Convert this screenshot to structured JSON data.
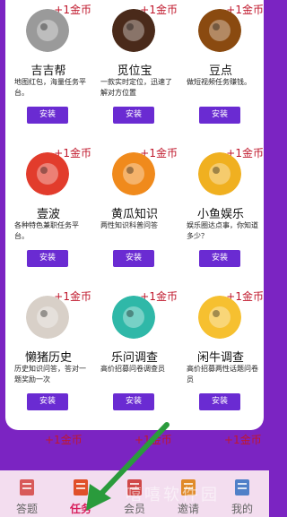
{
  "apps": [
    {
      "name": "吉吉帮",
      "desc": "地图红包，海量任务平台。",
      "reward": "+1金币",
      "button": "安装",
      "icon": "monkey-face-icon",
      "color": "#9a9a9a"
    },
    {
      "name": "觅位宝",
      "desc": "一款实时定位，迅速了解对方位置",
      "reward": "+1金币",
      "button": "安装",
      "icon": "location-pin-icon",
      "color": "#4a2a1a"
    },
    {
      "name": "豆点",
      "desc": "做短视频任务赚钱。",
      "reward": "+1金币",
      "button": "安装",
      "icon": "green-bean-icon",
      "color": "#8a4a10"
    },
    {
      "name": "壹波",
      "desc": "各种特色兼职任务平台。",
      "reward": "+1金币",
      "button": "安装",
      "icon": "red-letter-icon",
      "color": "#e23c2c"
    },
    {
      "name": "黄瓜知识",
      "desc": "两性知识科普问答",
      "reward": "+1金币",
      "button": "安装",
      "icon": "orange-leaf-icon",
      "color": "#f08a1c"
    },
    {
      "name": "小鱼娱乐",
      "desc": "娱乐圈达点事，你知道多少？",
      "reward": "+1金币",
      "button": "安装",
      "icon": "cartoon-fish-icon",
      "color": "#f0b020"
    },
    {
      "name": "懒猪历史",
      "desc": "历史知识问答，答对一题奖励一次",
      "reward": "+1金币",
      "button": "安装",
      "icon": "lazy-pig-icon",
      "color": "#d8d0c8"
    },
    {
      "name": "乐问调查",
      "desc": "高价招募问卷调查员",
      "reward": "+1金币",
      "button": "安装",
      "icon": "checklist-icon",
      "color": "#2fb8a8"
    },
    {
      "name": "闲牛调查",
      "desc": "高价招募两性话题问卷员",
      "reward": "+1金币",
      "button": "安装",
      "icon": "cartoon-cow-icon",
      "color": "#f6c030"
    }
  ],
  "peek_rewards": [
    "+1金币",
    "+1金币",
    "+1金币"
  ],
  "tabs": [
    {
      "label": "答题",
      "icon": "clipboard-icon",
      "color": "#d85a5a"
    },
    {
      "label": "任务",
      "icon": "task-book-icon",
      "color": "#e0502a"
    },
    {
      "label": "会员",
      "icon": "building-icon",
      "color": "#d04848"
    },
    {
      "label": "邀请",
      "icon": "person-icon",
      "color": "#e08a2a"
    },
    {
      "label": "我的",
      "icon": "profile-icon",
      "color": "#5080c8"
    }
  ],
  "active_tab": "任务",
  "watermark": "嘻嘻软件园"
}
